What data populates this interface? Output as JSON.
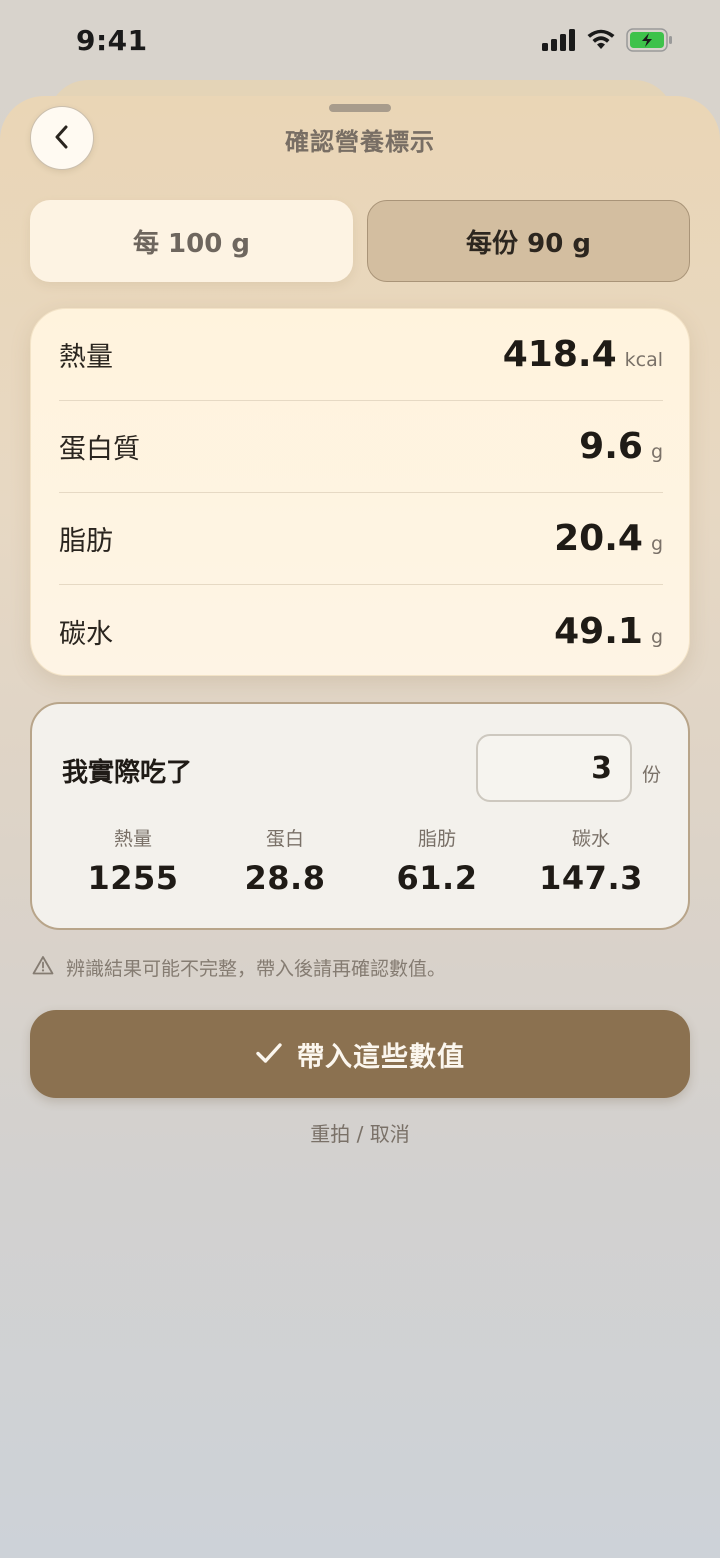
{
  "status_bar": {
    "time": "9:41",
    "signal_icon": "cellular-signal-icon",
    "wifi_icon": "wifi-icon",
    "battery_icon": "battery-charging-icon",
    "battery_color": "#3ec24a"
  },
  "header": {
    "title": "確認營養標示",
    "back_icon": "chevron-left-icon"
  },
  "segments": {
    "per_100": "每 100 g",
    "per_serving": "每份 90 g",
    "selected": "per_serving"
  },
  "nutrition": {
    "rows": [
      {
        "label": "熱量",
        "value": "418.4",
        "unit": "kcal"
      },
      {
        "label": "蛋白質",
        "value": "9.6",
        "unit": "g"
      },
      {
        "label": "脂肪",
        "value": "20.4",
        "unit": "g"
      },
      {
        "label": "碳水",
        "value": "49.1",
        "unit": "g"
      }
    ]
  },
  "eaten": {
    "label": "我實際吃了",
    "servings_value": "3",
    "servings_unit": "份",
    "macros": [
      {
        "label": "熱量",
        "value": "1255"
      },
      {
        "label": "蛋白",
        "value": "28.8"
      },
      {
        "label": "脂肪",
        "value": "61.2"
      },
      {
        "label": "碳水",
        "value": "147.3"
      }
    ]
  },
  "notice": {
    "icon": "warning-triangle-icon",
    "text": "辨識結果可能不完整，帶入後請再確認數值。"
  },
  "actions": {
    "submit_label": "帶入這些數值",
    "submit_icon": "checkmark-icon",
    "retake_label": "重拍 / 取消"
  },
  "colors": {
    "accent": "#8b7150",
    "segment_selected": "#d3bea0"
  }
}
